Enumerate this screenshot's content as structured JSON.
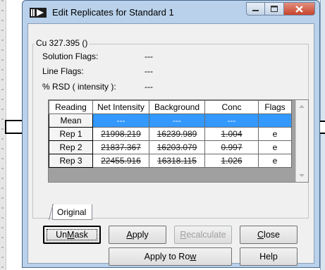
{
  "window": {
    "title": "Edit Replicates for Standard 1",
    "accent": "#3399ff"
  },
  "group": {
    "title": "Cu 327.395 ()",
    "info": [
      {
        "label": "Solution Flags:",
        "value": "---"
      },
      {
        "label": "Line Flags:",
        "value": "---"
      },
      {
        "label": "% RSD ( intensity ):",
        "value": "---"
      }
    ]
  },
  "grid": {
    "columns": [
      "Reading",
      "Net Intensity",
      "Background",
      "Conc",
      "Flags"
    ],
    "rows": [
      {
        "label": "Mean",
        "net": "---",
        "bg": "---",
        "conc": "---",
        "flags": ""
      },
      {
        "label": "Rep 1",
        "net": "21998.219",
        "bg": "16239.989",
        "conc": "1.004",
        "flags": "e"
      },
      {
        "label": "Rep 2",
        "net": "21837.367",
        "bg": "16203.079",
        "conc": "0.997",
        "flags": "e"
      },
      {
        "label": "Rep 3",
        "net": "22455.916",
        "bg": "16318.115",
        "conc": "1.026",
        "flags": "e"
      }
    ]
  },
  "tabs": [
    {
      "label": "Original"
    }
  ],
  "buttons": {
    "unmask": {
      "pre": "Un",
      "ul": "M",
      "post": "ask"
    },
    "apply": {
      "pre": "",
      "ul": "A",
      "post": "pply"
    },
    "recalculate": {
      "pre": "",
      "ul": "R",
      "post": "ecalculate"
    },
    "close": {
      "pre": "",
      "ul": "C",
      "post": "lose"
    },
    "apply_to_row": {
      "pre": "Apply to Ro",
      "ul": "w",
      "post": ""
    },
    "help": {
      "pre": "Help",
      "ul": "",
      "post": ""
    }
  }
}
